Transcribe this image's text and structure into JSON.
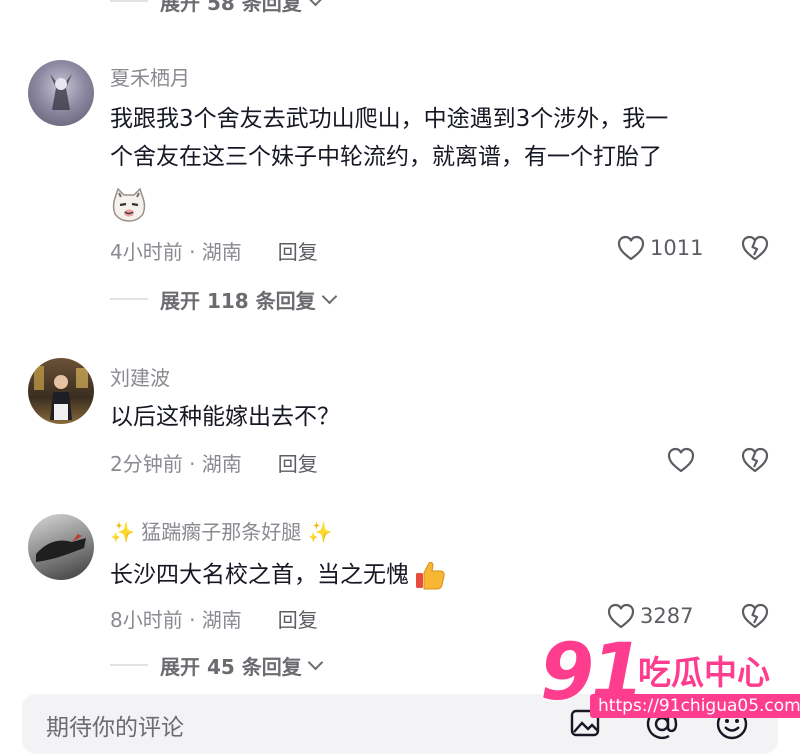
{
  "top_expand": {
    "label": "展开 58 条回复"
  },
  "comments": [
    {
      "username": "夏禾栖月",
      "text_line1": "我跟我3个舍友去武功山爬山，中途遇到3个涉外，我一",
      "text_line2": "个舍友在这三个妹子中轮流约，就离谱，有一个打胎了",
      "emoji": "cat-smirk-emoji",
      "meta": "4小时前 · 湖南",
      "reply_label": "回复",
      "likes": "1011",
      "expand_label": "展开 118 条回复"
    },
    {
      "username": "刘建波",
      "text": "以后这种能嫁出去不？",
      "meta": "2分钟前 · 湖南",
      "reply_label": "回复"
    },
    {
      "username": "✨ 猛踹瘸子那条好腿 ✨",
      "text": "长沙四大名校之首，当之无愧",
      "emoji": "thumbs-up-emoji",
      "meta": "8小时前 · 湖南",
      "reply_label": "回复",
      "likes": "3287",
      "expand_label": "展开 45 条回复"
    }
  ],
  "input": {
    "placeholder": "期待你的评论"
  },
  "watermark": {
    "number": "91",
    "label": "吃瓜中心",
    "url": "https://91chigua05.com"
  },
  "colors": {
    "text": "#161823",
    "muted": "#8a8b91",
    "watermark": "#ff3d8f"
  }
}
